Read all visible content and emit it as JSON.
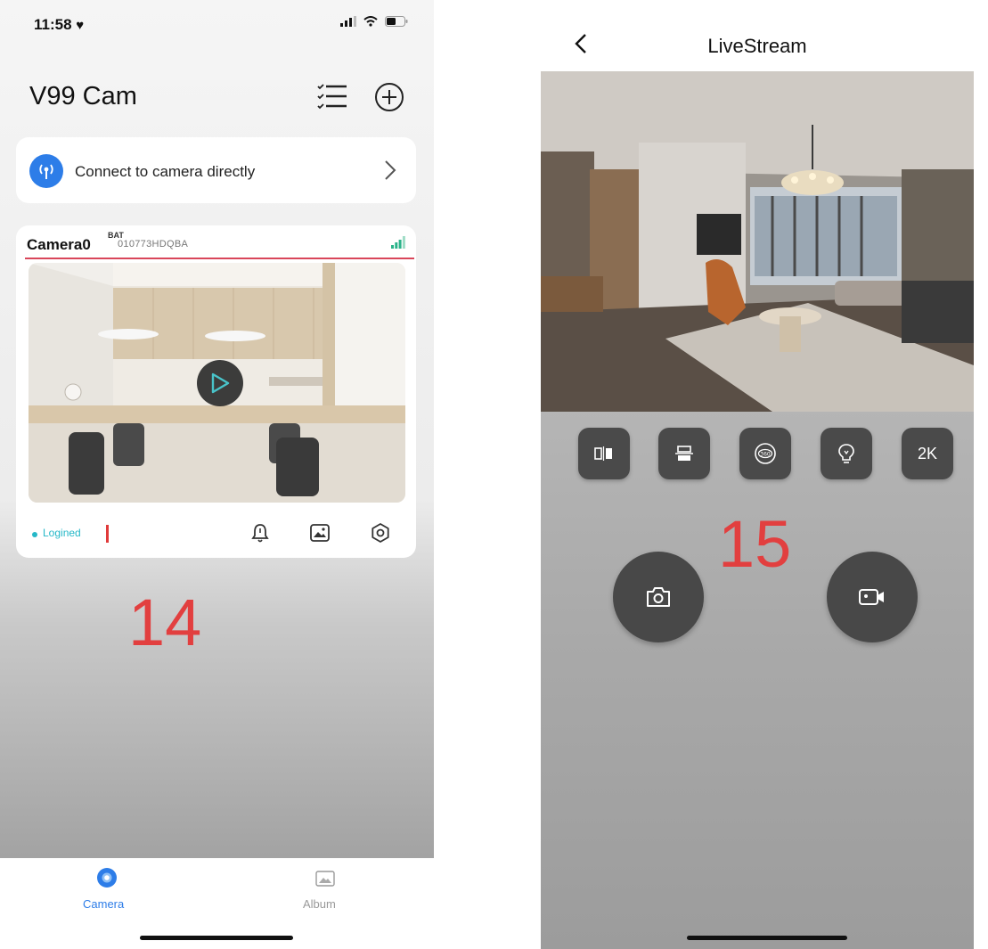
{
  "left_screen": {
    "status_bar": {
      "time": "11:58"
    },
    "header": {
      "title": "V99 Cam"
    },
    "connect_card": {
      "label": "Connect to camera directly"
    },
    "camera_card": {
      "name": "Camera0",
      "battery_badge": "BAT",
      "uid": "010773HDQBA",
      "status": "Logined"
    },
    "annotation": "14",
    "tabs": [
      {
        "label": "Camera",
        "active": true
      },
      {
        "label": "Album",
        "active": false
      }
    ]
  },
  "right_screen": {
    "title": "LiveStream",
    "controls": [
      {
        "icon": "mirror-icon"
      },
      {
        "icon": "flip-icon"
      },
      {
        "icon": "360-icon",
        "text": "360"
      },
      {
        "icon": "light-bulb-icon"
      },
      {
        "icon": "resolution-icon",
        "text": "2K"
      }
    ],
    "annotation": "15"
  },
  "colors": {
    "accent": "#2d7de8",
    "logined": "#26b8c8",
    "annotation": "#e23f3f",
    "divider": "#d9465a"
  }
}
